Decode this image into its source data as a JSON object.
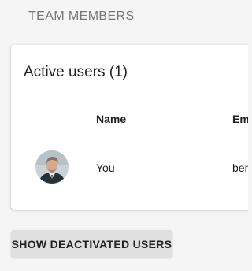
{
  "section": {
    "title": "TEAM MEMBERS"
  },
  "active_users": {
    "title": "Active users (1)",
    "columns": [
      "Name",
      "Em"
    ],
    "rows": [
      {
        "avatar_icon": "user-avatar-photo",
        "name": "You",
        "email": "ben"
      }
    ]
  },
  "actions": {
    "show_deactivated_label": "SHOW DEACTIVATED USERS"
  }
}
